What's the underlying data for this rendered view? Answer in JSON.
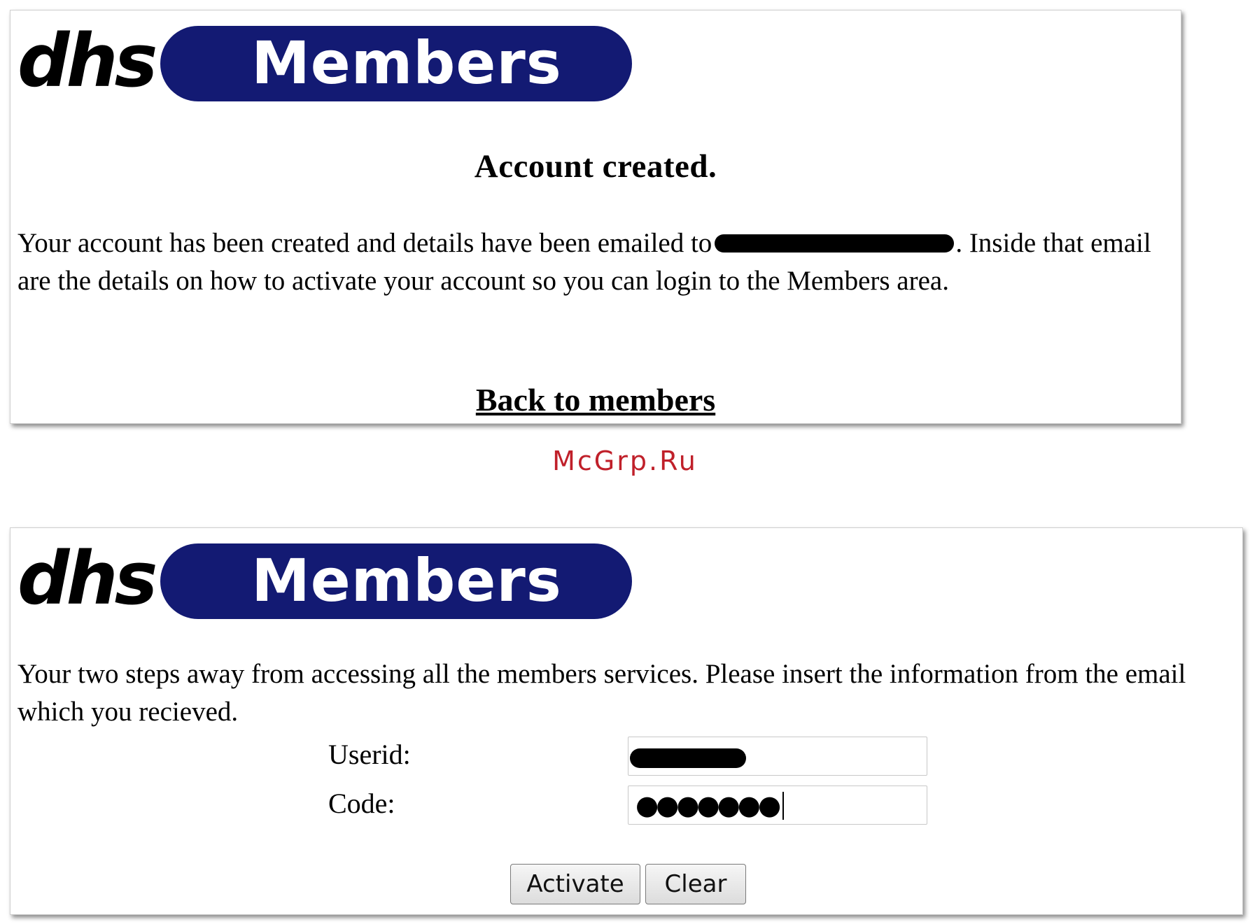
{
  "logo": {
    "brand": "dhs",
    "pill_text": "Members",
    "pill_color": "#131a73"
  },
  "panel1": {
    "heading": "Account created.",
    "paragraph_before_email": "Your account has been created and details have been emailed to",
    "paragraph_after_email": ". Inside that email are the details on how to activate your account so you can login to the Members area.",
    "back_link": "Back to members"
  },
  "watermark": {
    "text": "McGrp.Ru",
    "color": "#c0202a"
  },
  "panel2": {
    "paragraph": "Your two steps away from accessing all the members services. Please insert the information from the email which you recieved.",
    "userid_label": "Userid:",
    "code_label": "Code:",
    "code_value_masked": "●●●●●●●",
    "activate_button": "Activate",
    "clear_button": "Clear"
  }
}
